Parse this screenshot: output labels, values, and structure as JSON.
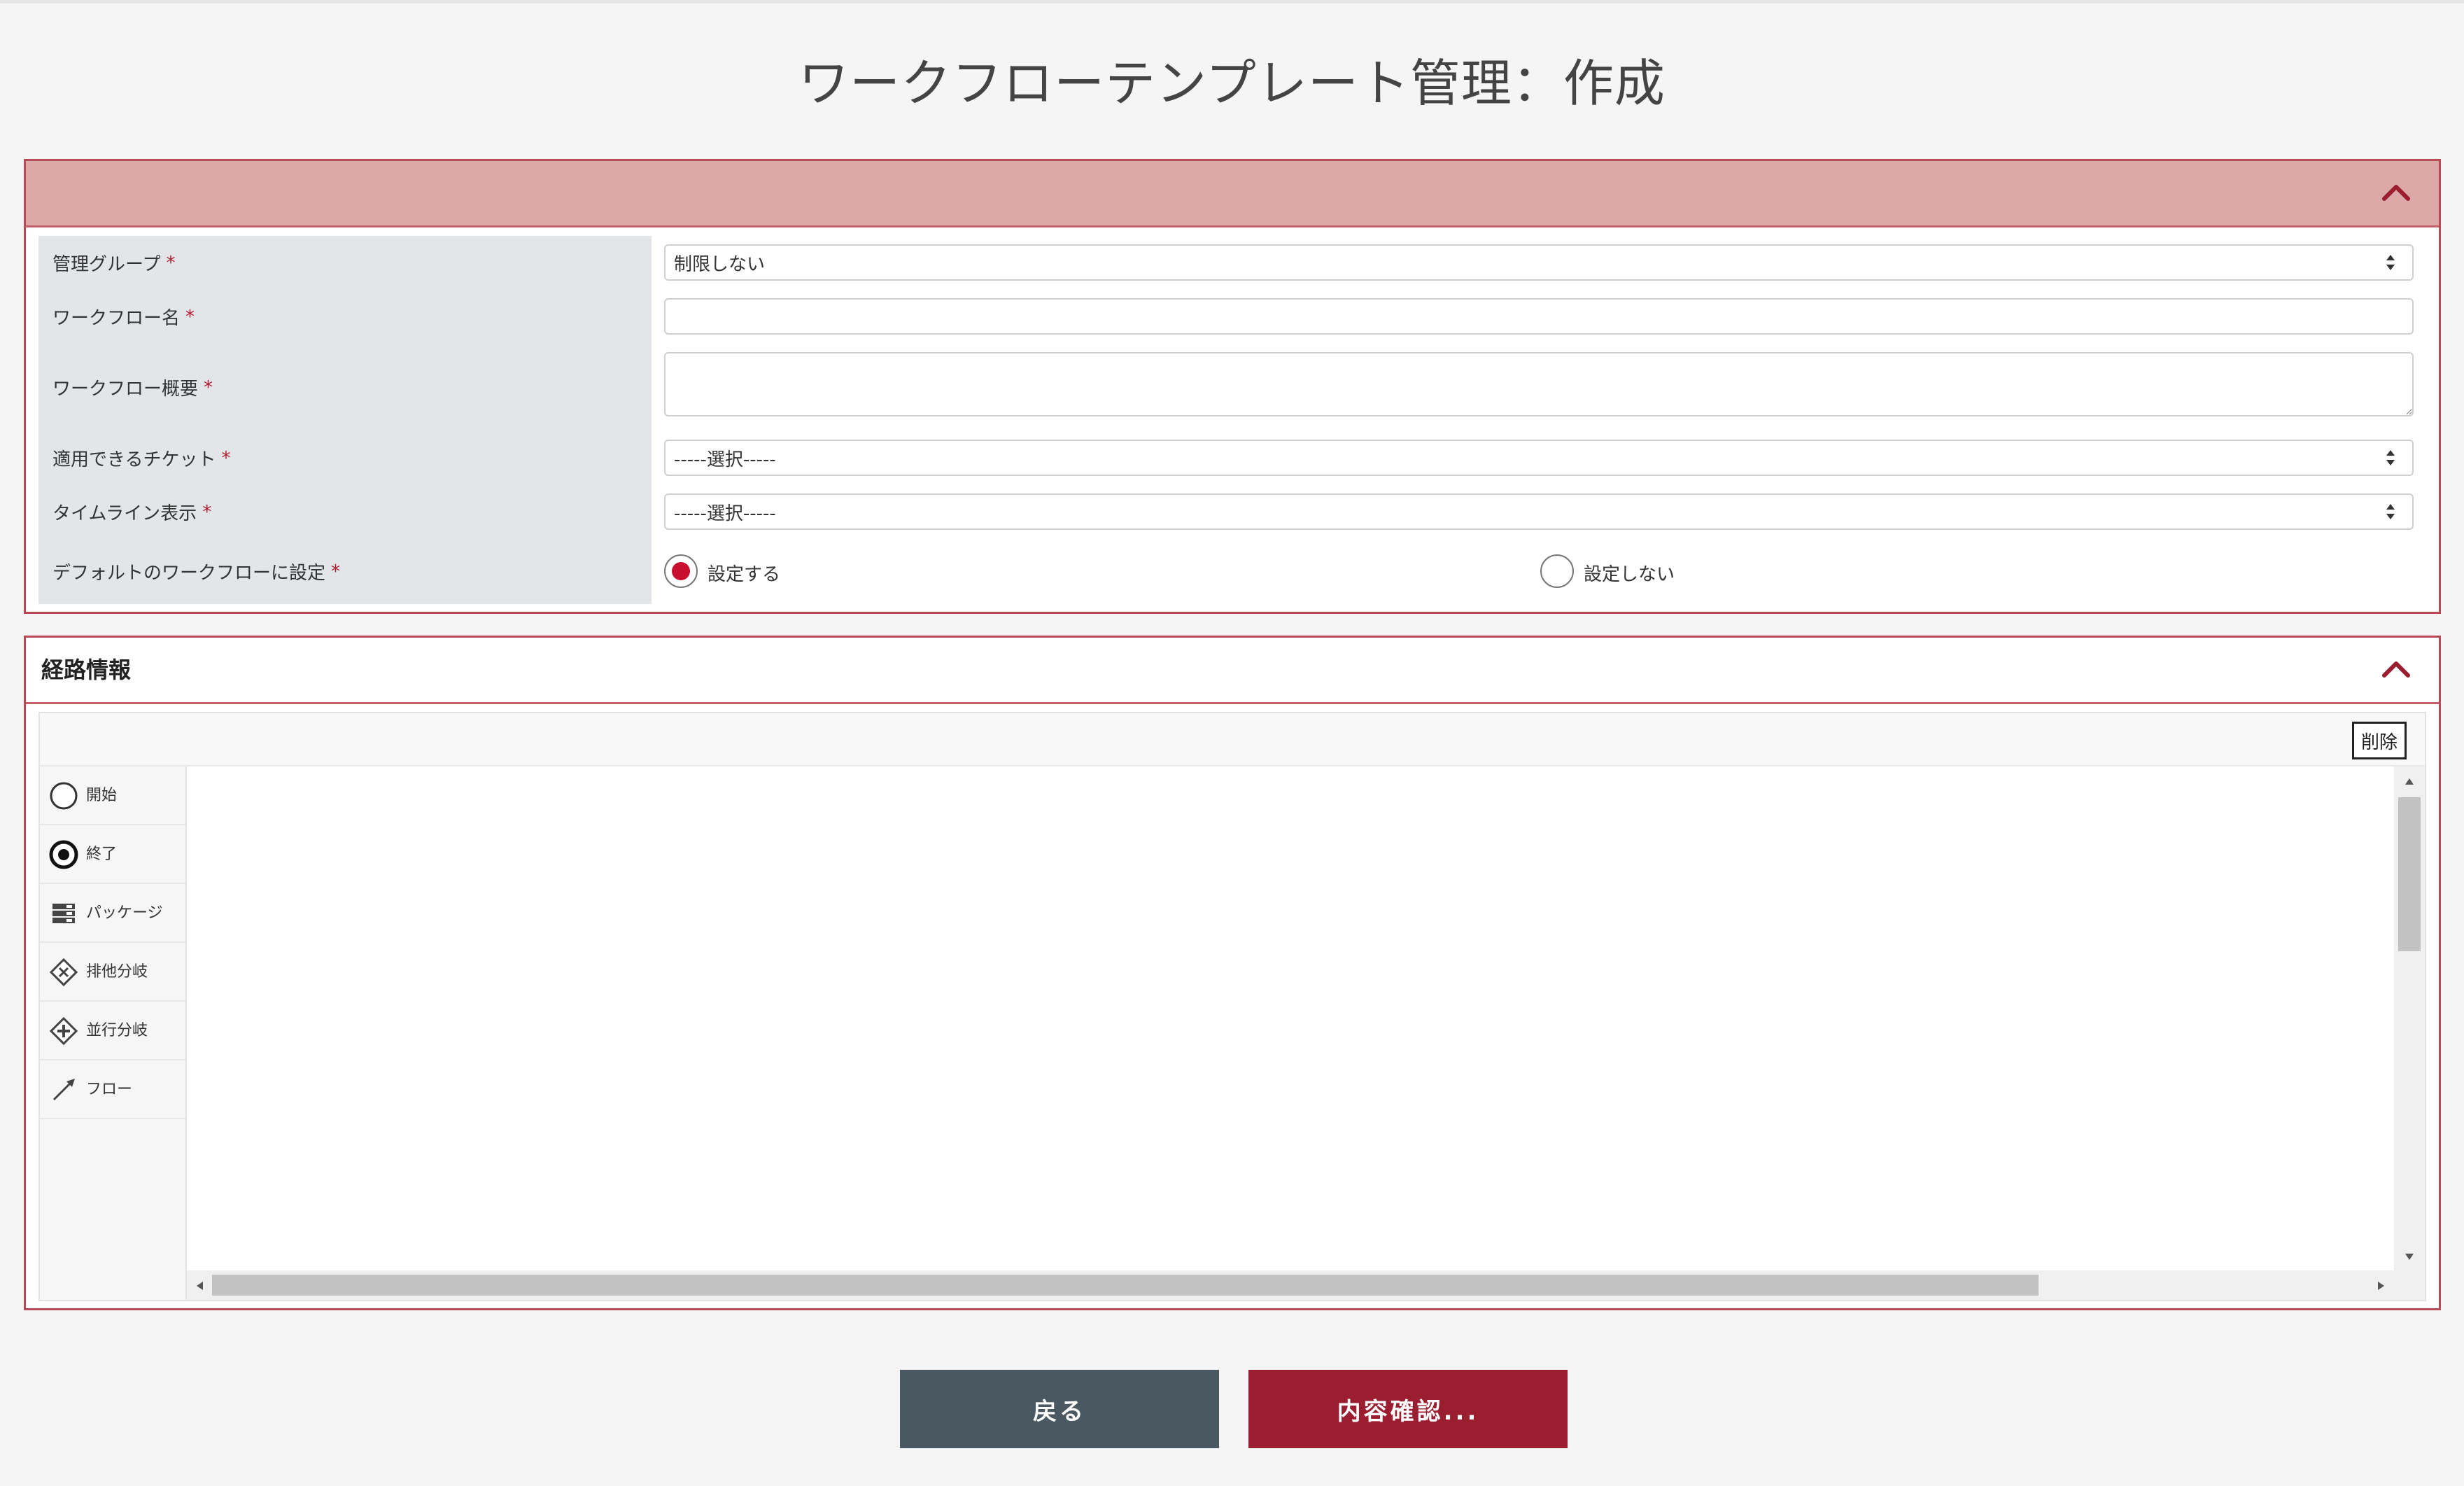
{
  "page": {
    "title": "ワークフローテンプレート管理：作成"
  },
  "basic_form": {
    "rows": [
      {
        "label": "管理グループ",
        "required_mark": "*",
        "type": "select",
        "value": "制限しない"
      },
      {
        "label": "ワークフロー名",
        "required_mark": "*",
        "type": "text",
        "value": ""
      },
      {
        "label": "ワークフロー概要",
        "required_mark": "*",
        "type": "textarea",
        "value": ""
      },
      {
        "label": "適用できるチケット",
        "required_mark": "*",
        "type": "select",
        "value": "-----選択-----"
      },
      {
        "label": "タイムライン表示",
        "required_mark": "*",
        "type": "select",
        "value": "-----選択-----"
      },
      {
        "label": "デフォルトのワークフローに設定",
        "required_mark": "*",
        "type": "radio",
        "options": [
          {
            "label": "設定する",
            "checked": true
          },
          {
            "label": "設定しない",
            "checked": false
          }
        ]
      }
    ]
  },
  "route_panel": {
    "title": "経路情報",
    "delete_label": "削除",
    "palette": [
      {
        "label": "開始",
        "icon": "start-circle-icon"
      },
      {
        "label": "終了",
        "icon": "end-circle-icon"
      },
      {
        "label": "パッケージ",
        "icon": "package-icon"
      },
      {
        "label": "排他分岐",
        "icon": "exclusive-gateway-icon"
      },
      {
        "label": "並行分岐",
        "icon": "parallel-gateway-icon"
      },
      {
        "label": "フロー",
        "icon": "flow-arrow-icon"
      }
    ]
  },
  "actions": {
    "back_label": "戻る",
    "confirm_label": "内容確認..."
  },
  "colors": {
    "accent": "#9b1d30",
    "panel_header": "#dca8a8",
    "back_button": "#4a5862",
    "radio_checked": "#c8102e"
  }
}
